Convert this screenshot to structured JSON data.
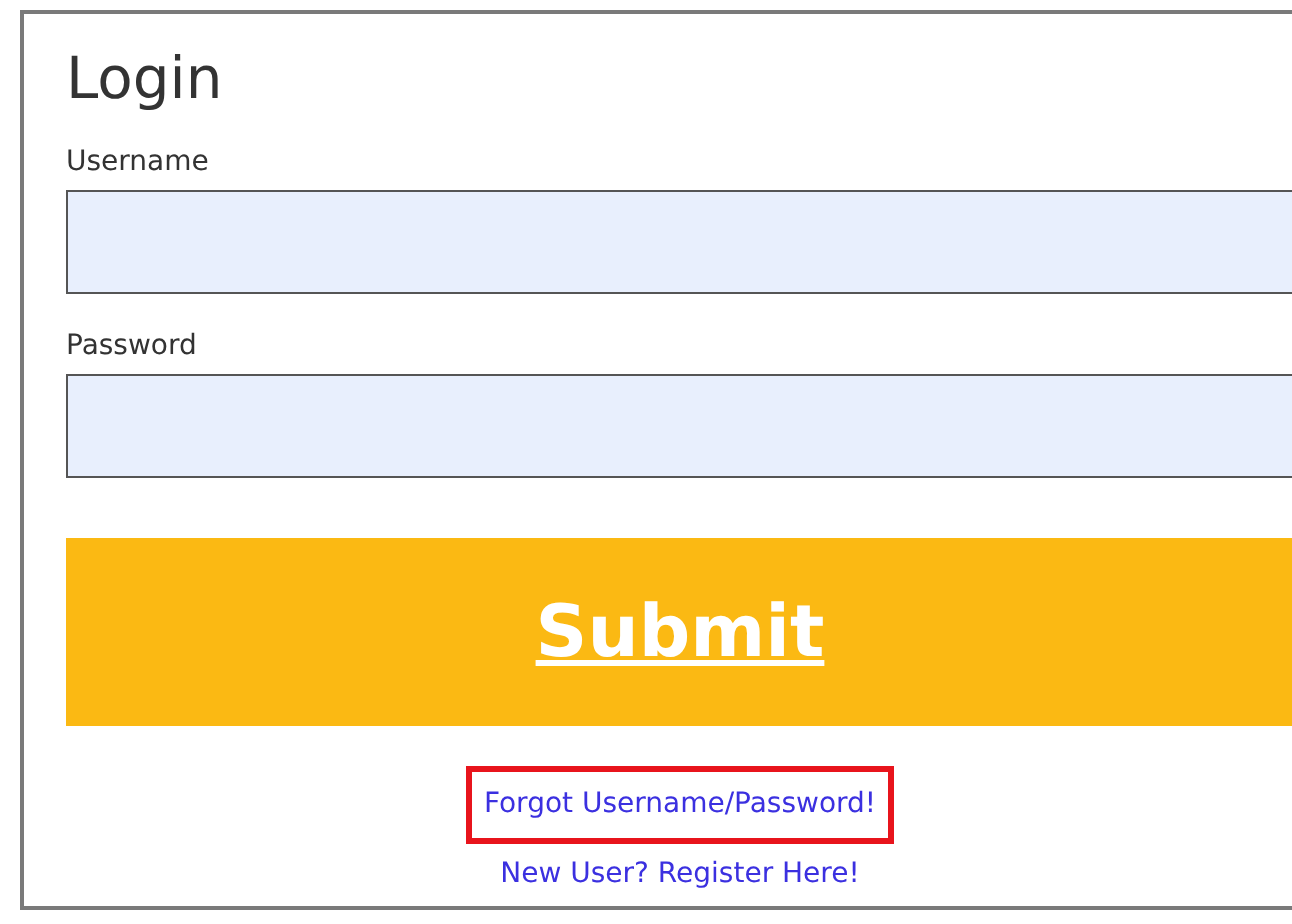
{
  "title": "Login",
  "fields": [
    {
      "label": "Username"
    },
    {
      "label": "Password"
    }
  ],
  "submit": "Submit",
  "links": [
    {
      "text": "Forgot Username/Password!",
      "highlighted": true
    },
    {
      "text": "New User? Register Here!",
      "highlighted": false
    }
  ]
}
